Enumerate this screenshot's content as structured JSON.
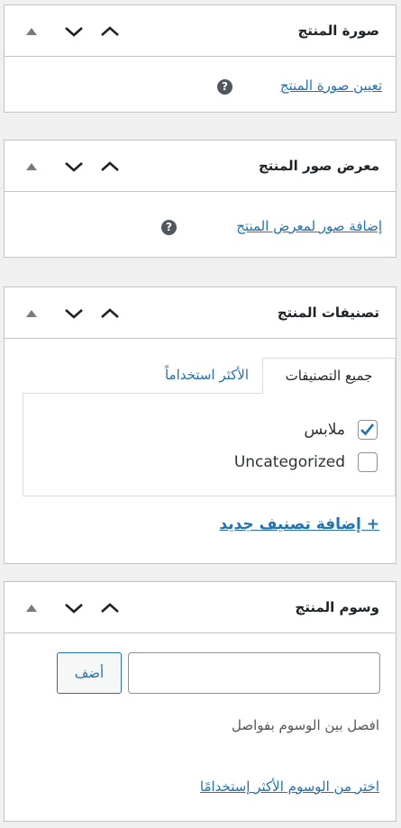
{
  "panels": {
    "image": {
      "title": "صورة المنتج",
      "link": "تعيين صورة المنتج",
      "help": "?"
    },
    "gallery": {
      "title": "معرض صور المنتج",
      "link": "إضافة صور لمعرض المنتج",
      "help": "?"
    },
    "categories": {
      "title": "تصنيفات المنتج",
      "tabs": [
        "جميع التصنيفات",
        "الأكثر استخداماً"
      ],
      "items": [
        {
          "label": "ملابس",
          "checked": true
        },
        {
          "label": "Uncategorized",
          "checked": false
        }
      ],
      "add_link": "+ إضافة تصنيف جديد"
    },
    "tags": {
      "title": "وسوم المنتج",
      "input_value": "",
      "add_button": "أضف",
      "hint": "افصل بين الوسوم بفواصل",
      "choose_link": "اختر من الوسوم الأكثر إستخدامًا"
    }
  },
  "colors": {
    "background": "#f0f0f1",
    "link": "#2271b1",
    "border": "#c3c4c7",
    "checkbox_check": "#2271b1"
  },
  "icons": {
    "move_up_small": "triangle-up-icon",
    "move_down": "chevron-down-icon",
    "move_up": "chevron-up-icon",
    "help": "help-icon",
    "check": "checkmark-icon"
  }
}
